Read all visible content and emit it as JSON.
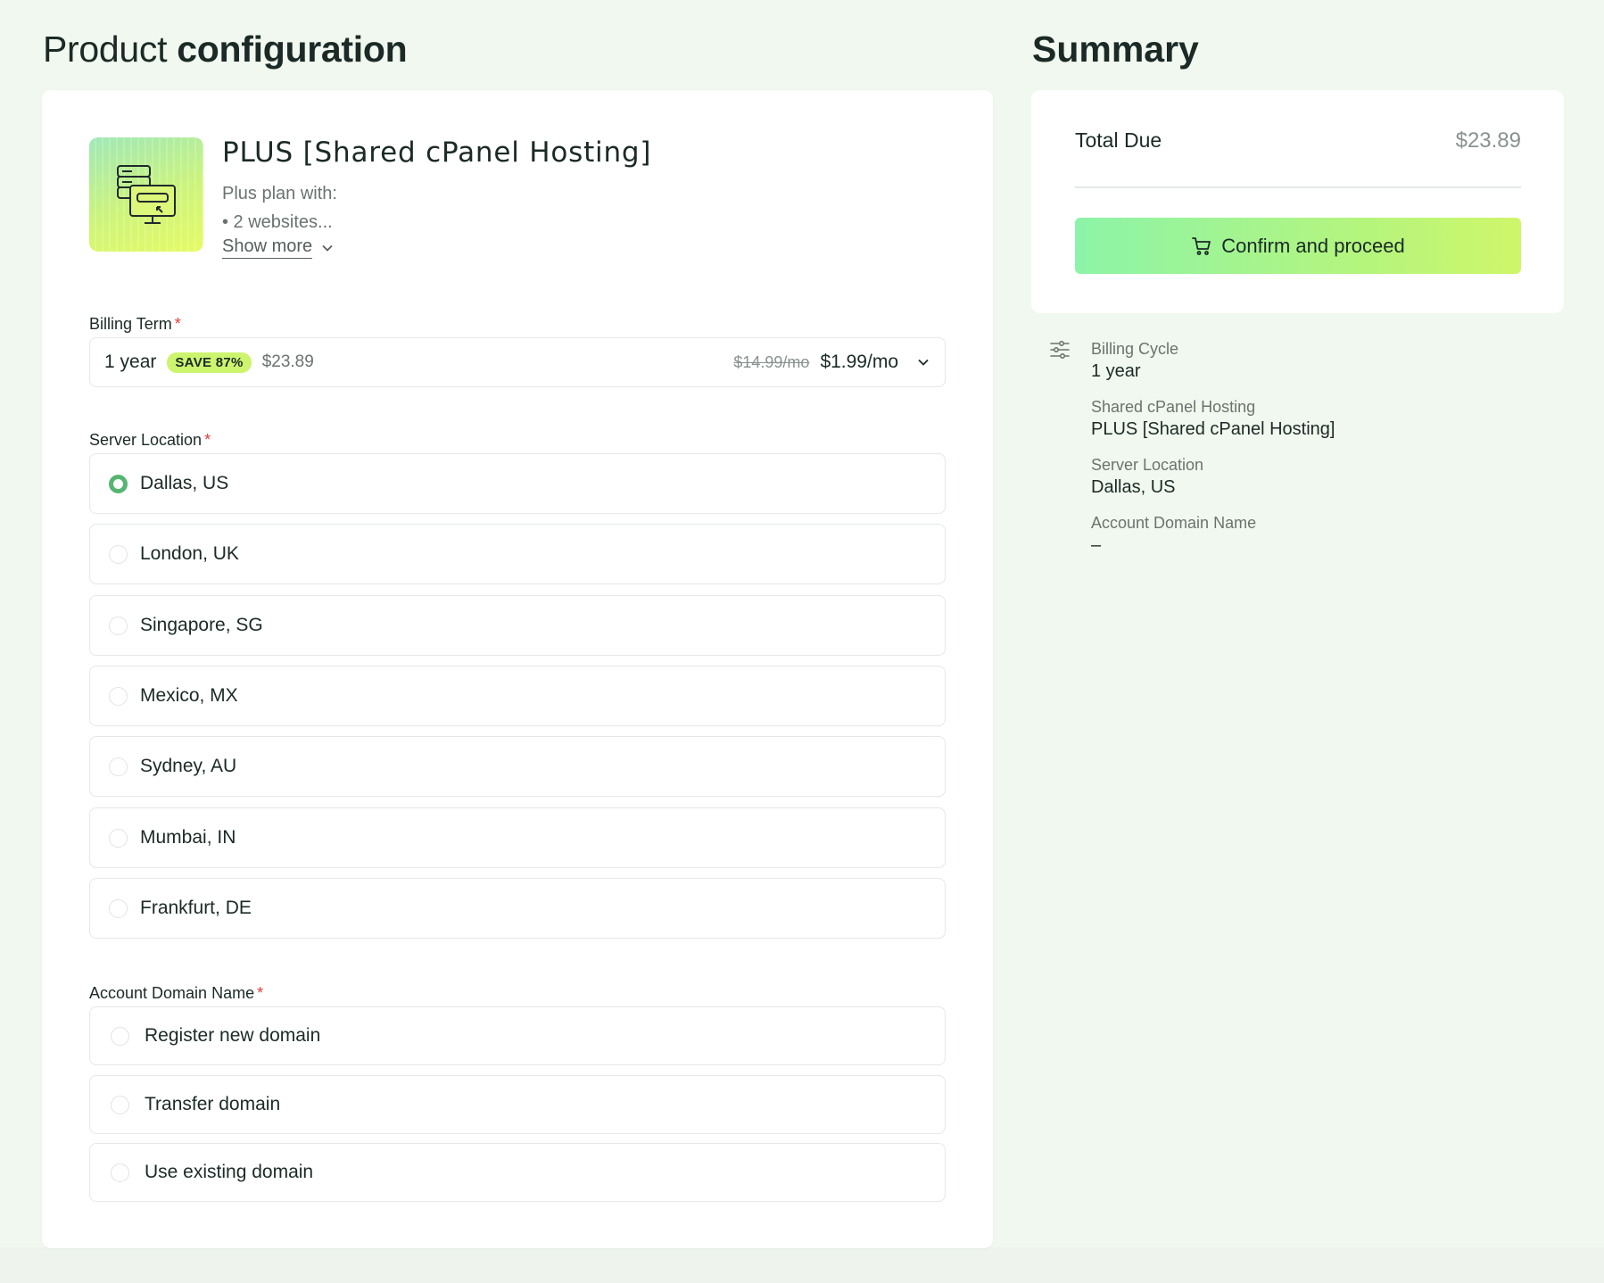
{
  "config": {
    "title_regular": "Product",
    "title_bold": "configuration",
    "product": {
      "name": "PLUS [Shared cPanel Hosting]",
      "desc_line1": "Plus plan with:",
      "desc_line2": "• 2 websites...",
      "show_more": "Show more"
    },
    "billing_term": {
      "label": "Billing Term",
      "required": "*",
      "term": "1 year",
      "badge": "SAVE 87%",
      "total": "$23.89",
      "old_price": "$14.99/mo",
      "new_price": "$1.99/mo"
    },
    "server_location": {
      "label": "Server Location",
      "required": "*",
      "options": [
        {
          "label": "Dallas, US",
          "selected": true
        },
        {
          "label": "London, UK",
          "selected": false
        },
        {
          "label": "Singapore, SG",
          "selected": false
        },
        {
          "label": "Mexico, MX",
          "selected": false
        },
        {
          "label": "Sydney, AU",
          "selected": false
        },
        {
          "label": "Mumbai, IN",
          "selected": false
        },
        {
          "label": "Frankfurt, DE",
          "selected": false
        }
      ]
    },
    "domain": {
      "label": "Account Domain Name",
      "required": "*",
      "options": [
        {
          "label": "Register new domain",
          "selected": false
        },
        {
          "label": "Transfer domain",
          "selected": false
        },
        {
          "label": "Use existing domain",
          "selected": false
        }
      ]
    }
  },
  "summary": {
    "title": "Summary",
    "total_label": "Total Due",
    "total_value": "$23.89",
    "confirm_label": "Confirm and proceed",
    "items": [
      {
        "key": "Billing Cycle",
        "value": "1 year"
      },
      {
        "key": "Shared cPanel Hosting",
        "value": "PLUS [Shared cPanel Hosting]"
      },
      {
        "key": "Server Location",
        "value": "Dallas, US"
      },
      {
        "key": "Account Domain Name",
        "value": "–"
      }
    ]
  },
  "icons": {
    "product": "hosting-monitor-icon",
    "chevron": "chevron-down-icon",
    "cart": "cart-icon",
    "settings": "sliders-icon"
  },
  "colors": {
    "page_bg": "#f1f8ef",
    "accent_green": "#55b672",
    "badge_bg": "#cdf46e",
    "required": "#e23b3b",
    "button_gradient_start": "#8cf4a8",
    "button_gradient_end": "#cff66a"
  }
}
